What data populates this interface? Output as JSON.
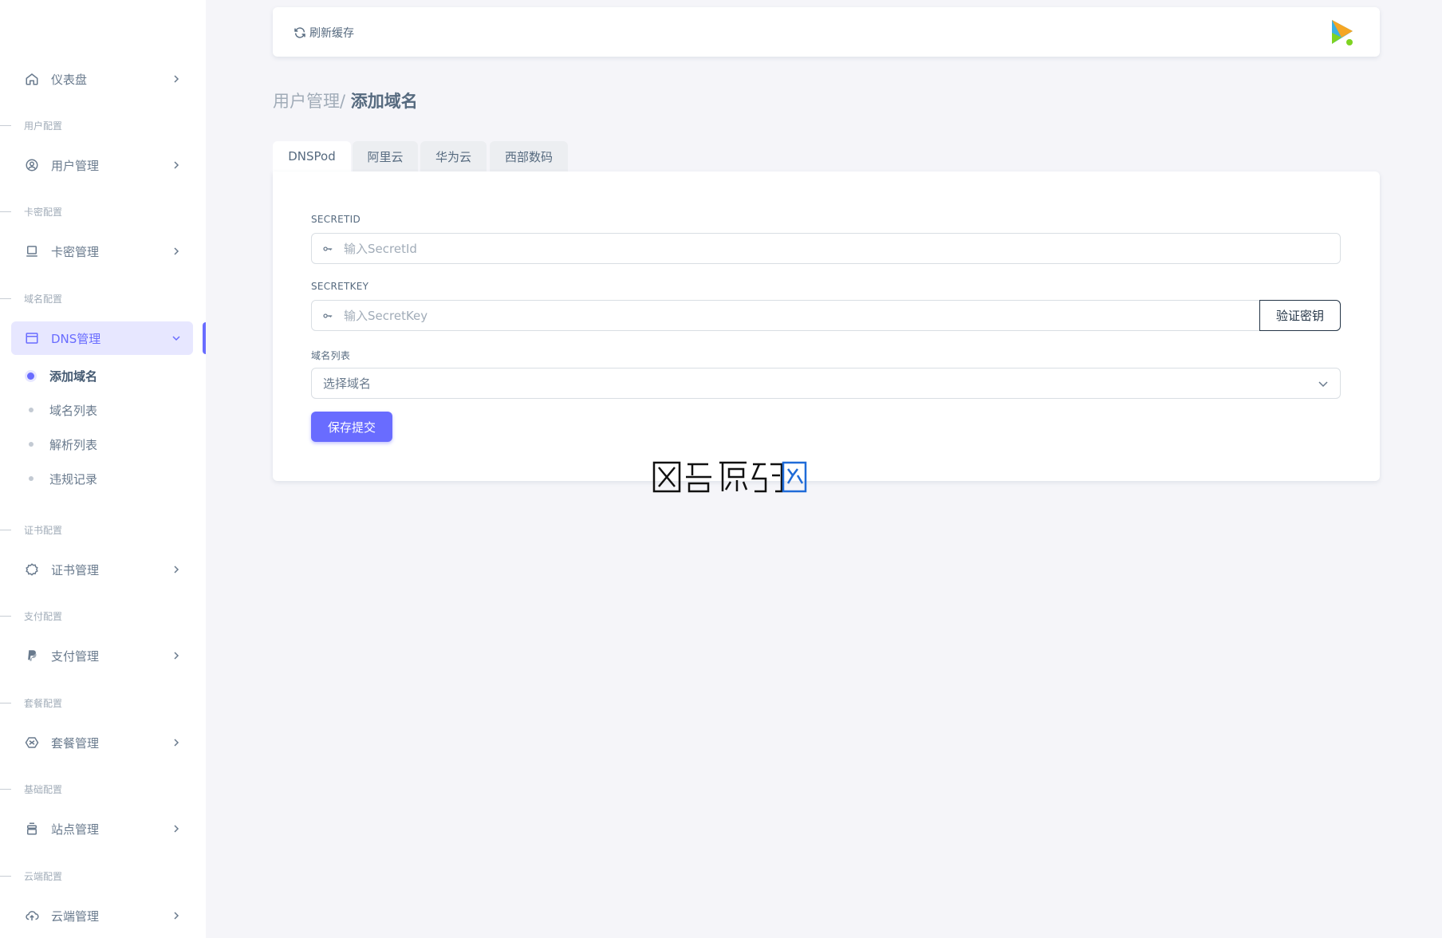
{
  "sidebar": {
    "dashboard": "仪表盘",
    "sections": {
      "user": "用户配置",
      "card": "卡密配置",
      "domain": "域名配置",
      "cert": "证书配置",
      "pay": "支付配置",
      "package": "套餐配置",
      "base": "基础配置",
      "cloud": "云端配置"
    },
    "items": {
      "user": "用户管理",
      "card": "卡密管理",
      "dns": "DNS管理",
      "cert": "证书管理",
      "pay": "支付管理",
      "package": "套餐管理",
      "site": "站点管理",
      "cloud": "云端管理"
    },
    "dns_sub": [
      "添加域名",
      "域名列表",
      "解析列表",
      "违规记录"
    ]
  },
  "navbar": {
    "refresh_label": "刷新缓存"
  },
  "breadcrumb": {
    "parent": "用户管理/ ",
    "current": "添加域名"
  },
  "tabs": [
    "DNSPod",
    "阿里云",
    "华为云",
    "西部数码"
  ],
  "form": {
    "secretid_label": "SECRETID",
    "secretid_placeholder": "输入SecretId",
    "secretkey_label": "SECRETKEY",
    "secretkey_placeholder": "输入SecretKey",
    "verify_button": "验证密钥",
    "domain_list_label": "域名列表",
    "domain_select_value": "选择域名",
    "save_button": "保存提交"
  },
  "colors": {
    "primary": "#696cff",
    "primary_light": "#e7e7ff",
    "background": "#f5f5f9"
  }
}
